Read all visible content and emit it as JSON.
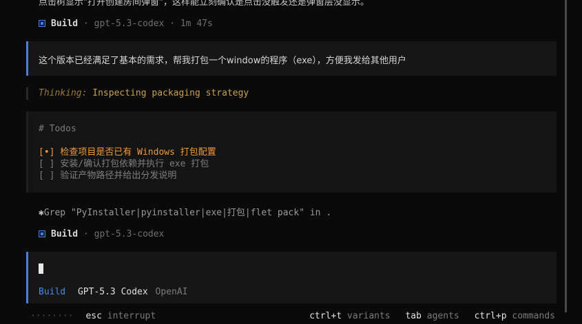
{
  "transcript": {
    "prev_text_cut": "点击树显示\"打开创建房间弹窗\"，这样能立刻确认是点击没触发还是弹窗层没显示。",
    "build_meta_1": {
      "agent": "Build",
      "sep1": "·",
      "model": "gpt-5.3-codex",
      "sep2": "·",
      "duration": "1m 47s"
    },
    "user_message": "这个版本已经满足了基本的需求，帮我打包一个window的程序（exe），方便我发给其他用户",
    "thinking": {
      "label": "Thinking:",
      "text": "Inspecting packaging strategy"
    },
    "todos": {
      "header": "# Todos",
      "items": [
        {
          "mark": "[•]",
          "text": "检查项目是否已有 Windows 打包配置",
          "status": "in_progress"
        },
        {
          "mark": "[ ]",
          "text": "安装/确认打包依赖并执行 exe 打包",
          "status": "pending"
        },
        {
          "mark": "[ ]",
          "text": "验证产物路径并给出分发说明",
          "status": "pending"
        }
      ]
    },
    "grep": {
      "icon": "✱",
      "text": "Grep \"PyInstaller|pyinstaller|exe|打包|flet pack\" in ."
    },
    "build_meta_2": {
      "agent": "Build",
      "sep1": "·",
      "model": "gpt-5.3-codex"
    }
  },
  "input": {
    "agent": "Build",
    "model": "GPT-5.3 Codex",
    "provider": "OpenAI"
  },
  "footer": {
    "dots": "········",
    "esc_key": "esc",
    "esc_desc": "interrupt",
    "shortcuts": [
      {
        "key": "ctrl+t",
        "desc": "variants"
      },
      {
        "key": "tab",
        "desc": "agents"
      },
      {
        "key": "ctrl+p",
        "desc": "commands"
      }
    ]
  },
  "colors": {
    "background": "#0a0a0a",
    "panel": "#161616",
    "accent_blue": "#4a7fe0",
    "todo_active": "#f09a3a",
    "thinking_label": "#9a7a3a"
  }
}
